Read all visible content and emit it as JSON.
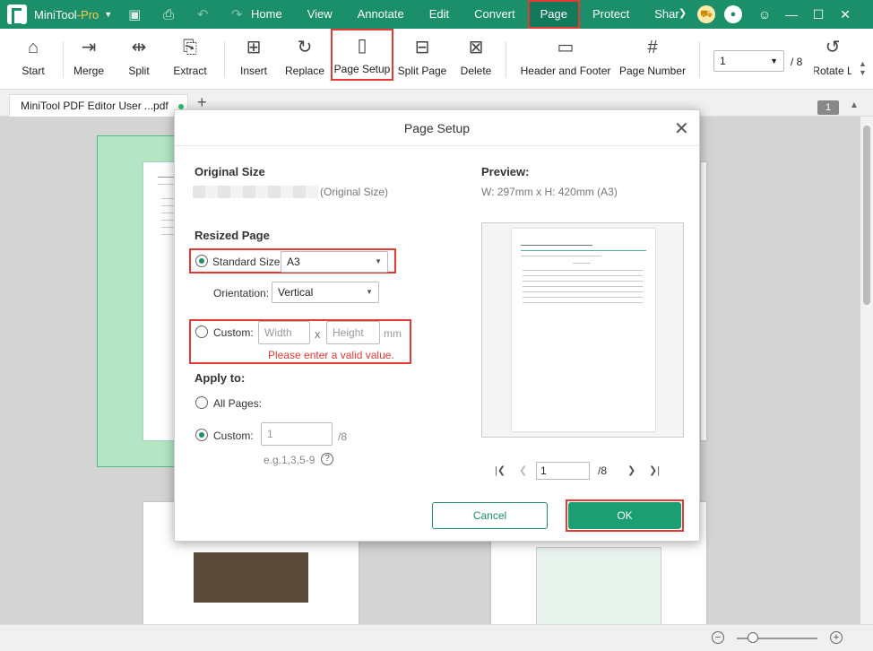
{
  "app": {
    "name": "MiniTool",
    "name_suffix": "-Pro"
  },
  "menus": [
    "Home",
    "View",
    "Annotate",
    "Edit",
    "Convert",
    "Page",
    "Protect",
    "Shar"
  ],
  "active_menu": "Page",
  "toolbar": {
    "start": "Start",
    "merge": "Merge",
    "split": "Split",
    "extract": "Extract",
    "insert": "Insert",
    "replace": "Replace",
    "page_setup": "Page Setup",
    "split_page": "Split Page",
    "delete": "Delete",
    "header_footer": "Header and Footer",
    "page_number": "Page Number",
    "page_value": "1",
    "page_total": "/ 8",
    "rotate": "Rotate L"
  },
  "tabs": {
    "doc": "MiniTool PDF Editor User ...pdf",
    "add": "+",
    "page_badge": "1"
  },
  "dialog": {
    "title": "Page Setup",
    "original_size_title": "Original Size",
    "original_size_suffix": "(Original Size)",
    "resized_title": "Resized Page",
    "standard_size_label": "Standard Size:",
    "standard_size_value": "A3",
    "orientation_label": "Orientation:",
    "orientation_value": "Vertical",
    "custom_label": "Custom:",
    "width_placeholder": "Width",
    "x_sep": "x",
    "height_placeholder": "Height",
    "unit": "mm",
    "error": "Please enter a valid value.",
    "apply_title": "Apply to:",
    "all_pages": "All Pages:",
    "custom_pages_label": "Custom:",
    "custom_pages_value": "1",
    "custom_pages_total": "/8",
    "example": "e.g.1,3,5-9",
    "preview_title": "Preview:",
    "preview_size": "W: 297mm x H: 420mm (A3)",
    "preview_page_value": "1",
    "preview_page_total": "/8",
    "cancel": "Cancel",
    "ok": "OK"
  },
  "colors": {
    "brand": "#1a8f6a",
    "highlight": "#e53935",
    "ok": "#1a9e72"
  }
}
